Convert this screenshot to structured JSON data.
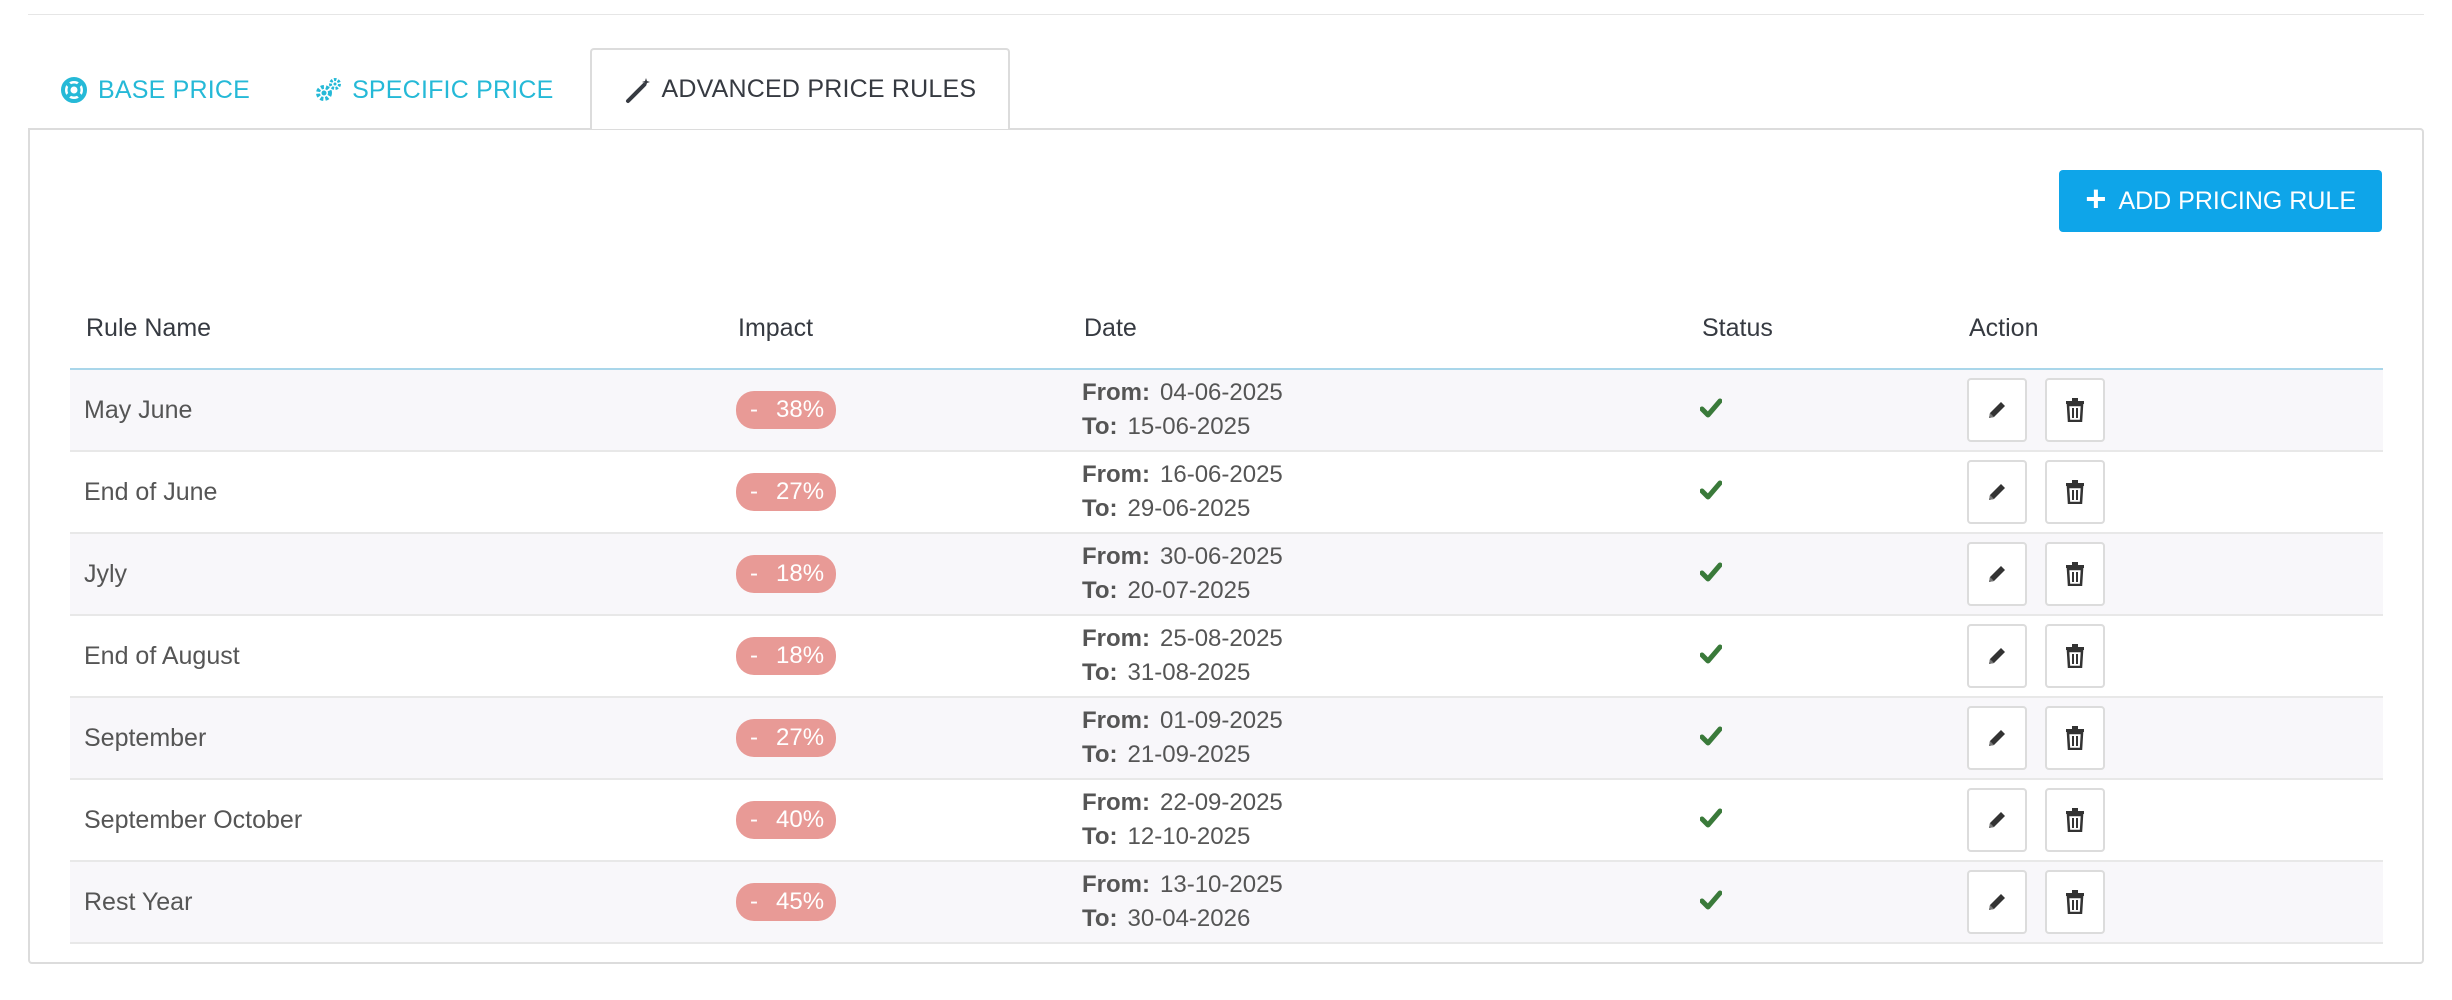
{
  "tabs": [
    {
      "label": "BASE PRICE",
      "icon": "lifebuoy-icon"
    },
    {
      "label": "SPECIFIC PRICE",
      "icon": "gears-icon"
    },
    {
      "label": "ADVANCED PRICE RULES",
      "icon": "magic-wand-icon"
    }
  ],
  "toolbar": {
    "add_label": "ADD PRICING RULE"
  },
  "table": {
    "headers": {
      "name": "Rule Name",
      "impact": "Impact",
      "date": "Date",
      "status": "Status",
      "action": "Action"
    },
    "from_label": "From:",
    "to_label": "To:",
    "rows": [
      {
        "name": "May June",
        "sign": "-",
        "impact": "38%",
        "from": "04-06-2025",
        "to": "15-06-2025",
        "status": "active"
      },
      {
        "name": "End of June",
        "sign": "-",
        "impact": "27%",
        "from": "16-06-2025",
        "to": "29-06-2025",
        "status": "active"
      },
      {
        "name": "Jyly",
        "sign": "-",
        "impact": "18%",
        "from": "30-06-2025",
        "to": "20-07-2025",
        "status": "active"
      },
      {
        "name": "End of August",
        "sign": "-",
        "impact": "18%",
        "from": "25-08-2025",
        "to": "31-08-2025",
        "status": "active"
      },
      {
        "name": "September",
        "sign": "-",
        "impact": "27%",
        "from": "01-09-2025",
        "to": "21-09-2025",
        "status": "active"
      },
      {
        "name": "September October",
        "sign": "-",
        "impact": "40%",
        "from": "22-09-2025",
        "to": "12-10-2025",
        "status": "active"
      },
      {
        "name": "Rest Year",
        "sign": "-",
        "impact": "45%",
        "from": "13-10-2025",
        "to": "30-04-2026",
        "status": "active"
      }
    ]
  },
  "colors": {
    "accent": "#25b9d7",
    "button": "#0ea5e9",
    "impact_badge": "#e89a96",
    "status_ok": "#3a7a3a"
  }
}
